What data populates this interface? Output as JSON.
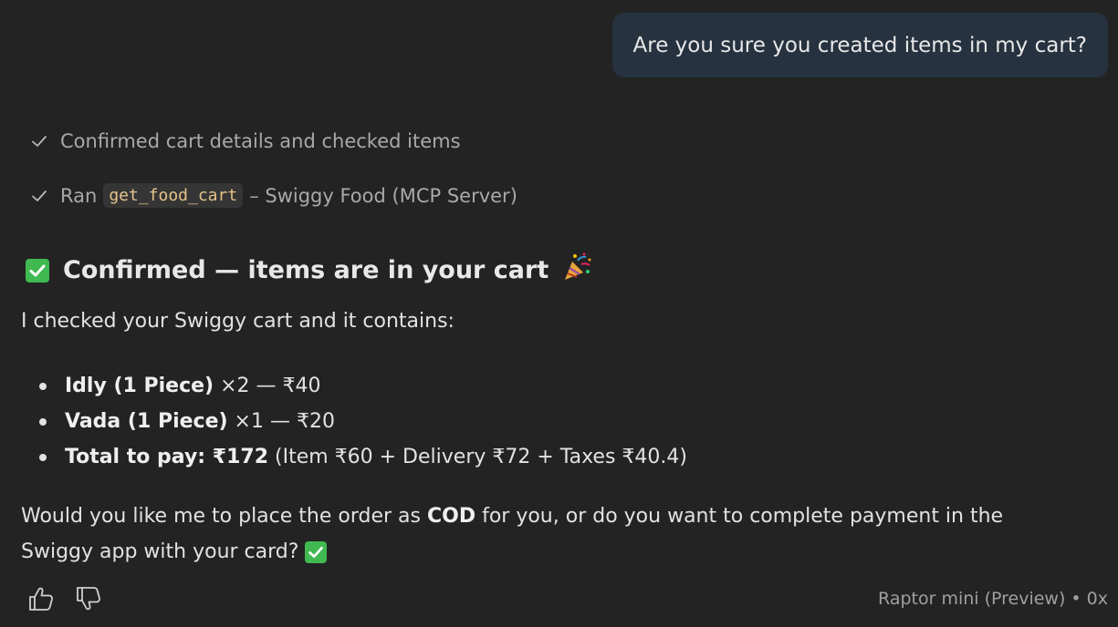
{
  "user_message": "Are you sure you created items in my cart?",
  "steps": [
    {
      "text": "Confirmed cart details and checked items"
    },
    {
      "prefix": "Ran",
      "code": "get_food_cart",
      "suffix": "– Swiggy Food (MCP Server)"
    }
  ],
  "response": {
    "heading": "Confirmed — items are in your cart",
    "heading_emoji": "🎉",
    "intro": "I checked your Swiggy cart and it contains:",
    "items": [
      {
        "bold": "Idly (1 Piece)",
        "rest": " ×2 — ₹40"
      },
      {
        "bold": "Vada (1 Piece)",
        "rest": " ×1 — ₹20"
      },
      {
        "bold": "Total to pay: ₹172",
        "rest": " (Item ₹60 + Delivery ₹72 + Taxes ₹40.4)"
      }
    ],
    "question_line1_pre": "Would you like me to place the order as ",
    "question_line1_bold": "COD",
    "question_line1_post": " for you, or do you want to complete payment in the",
    "question_line2": "Swiggy app with your card? "
  },
  "footer": {
    "model_info": "Raptor mini (Preview) • 0x"
  },
  "icons": {
    "step_check": "checkmark-icon",
    "confirmed": "green-checkbox-emoji-icon",
    "party": "party-popper-icon",
    "like": "thumbs-up-icon",
    "dislike": "thumbs-down-icon"
  },
  "colors": {
    "background": "#232323",
    "user_bubble": "#26323f",
    "code_text": "#e3c38a",
    "green_check": "#3fb950"
  }
}
